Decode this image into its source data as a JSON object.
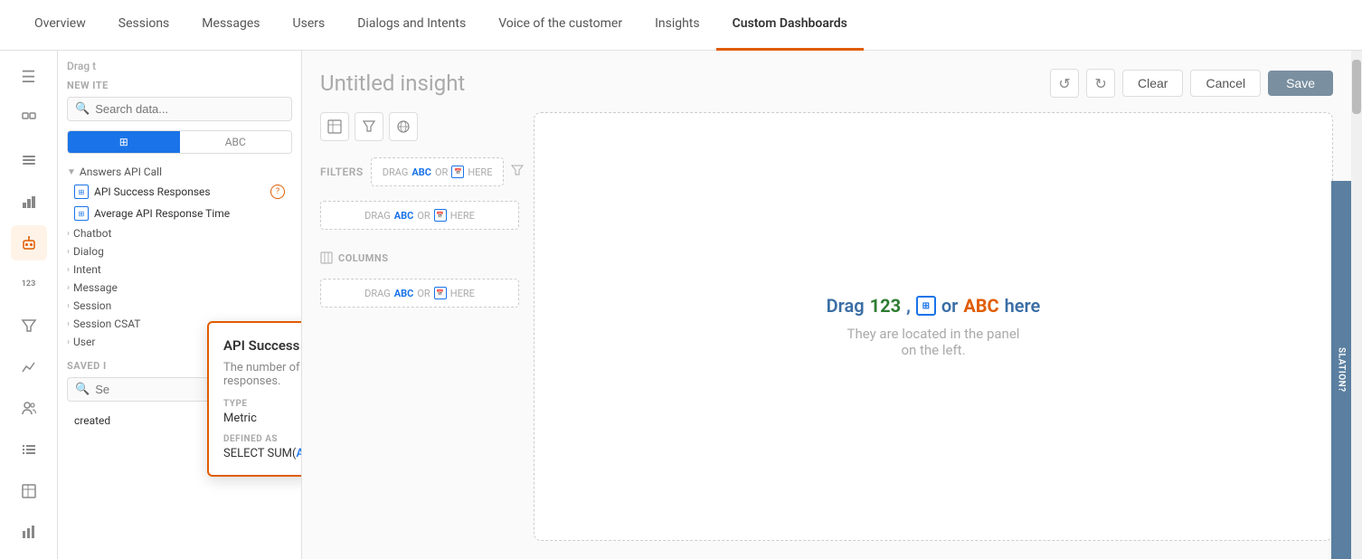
{
  "nav": {
    "tabs": [
      {
        "id": "overview",
        "label": "Overview",
        "active": false
      },
      {
        "id": "sessions",
        "label": "Sessions",
        "active": false
      },
      {
        "id": "messages",
        "label": "Messages",
        "active": false
      },
      {
        "id": "users",
        "label": "Users",
        "active": false
      },
      {
        "id": "dialogs-intents",
        "label": "Dialogs and Intents",
        "active": false
      },
      {
        "id": "voice-customer",
        "label": "Voice of the customer",
        "active": false
      },
      {
        "id": "insights",
        "label": "Insights",
        "active": false
      },
      {
        "id": "custom-dashboards",
        "label": "Custom Dashboards",
        "active": true
      }
    ]
  },
  "sidebar": {
    "icons": [
      {
        "name": "menu-icon",
        "symbol": "☰",
        "active": false
      },
      {
        "name": "plugin-icon",
        "symbol": "⊞",
        "active": false
      },
      {
        "name": "grid-icon",
        "symbol": "⊟",
        "active": false
      },
      {
        "name": "chart-icon",
        "symbol": "▦",
        "active": false
      },
      {
        "name": "bot-icon",
        "symbol": "🤖",
        "active": true
      },
      {
        "name": "number-icon",
        "symbol": "123",
        "active": false
      },
      {
        "name": "funnel-icon",
        "symbol": "⊽",
        "active": false
      },
      {
        "name": "analytics-icon",
        "symbol": "📈",
        "active": false
      },
      {
        "name": "users-icon",
        "symbol": "👥",
        "active": false
      },
      {
        "name": "list-icon",
        "symbol": "≡",
        "active": false
      },
      {
        "name": "table-icon",
        "symbol": "⊞",
        "active": false
      },
      {
        "name": "chart2-icon",
        "symbol": "📊",
        "active": false
      }
    ]
  },
  "data_panel": {
    "drag_label": "Drag t",
    "new_items_label": "NEW ITE",
    "search_placeholder": "Search data...",
    "tab_numeric": "⊞",
    "tab_abc": "ABC",
    "categories": [
      {
        "label": "Answers API Call",
        "expanded": true
      },
      {
        "label": "Chatbot",
        "expanded": false
      },
      {
        "label": "Dialog",
        "expanded": false
      },
      {
        "label": "Intent",
        "expanded": false
      },
      {
        "label": "Message",
        "expanded": false
      },
      {
        "label": "Session",
        "expanded": false
      },
      {
        "label": "Session CSAT",
        "expanded": false
      },
      {
        "label": "User",
        "expanded": false
      }
    ],
    "api_items": [
      {
        "label": "API Success Responses",
        "has_tooltip": true
      },
      {
        "label": "Average API Response Time",
        "has_tooltip": false
      }
    ],
    "saved_label": "SAVED I",
    "saved_search_placeholder": "Se",
    "saved_item": "created"
  },
  "tooltip": {
    "title": "API Success Responses",
    "description": "The number of API success responses.",
    "type_label": "TYPE",
    "type_value": "Metric",
    "defined_as_label": "DEFINED AS",
    "query_prefix": "SELECT SUM(",
    "query_link": "API Response Success",
    "query_suffix": ")"
  },
  "content": {
    "insight_title": "Untitled insight",
    "toolbar": {
      "undo_label": "↺",
      "redo_label": "↻",
      "clear_label": "Clear",
      "cancel_label": "Cancel",
      "save_label": "Save"
    },
    "filters_label": "FILTERS",
    "drag_abc_here": "DRAG ABC OR",
    "drag_here": "HERE",
    "columns_label": "COLUMNS",
    "drop_area": {
      "main_text_prefix": "Drag ",
      "num_text": "123",
      "comma": ",",
      "or_text": " or ",
      "abc_text": "ABC",
      "main_text_suffix": " here",
      "sub_text_line1": "They are located in the panel",
      "sub_text_line2": "on the left."
    }
  },
  "translation_label": "SLATION?"
}
